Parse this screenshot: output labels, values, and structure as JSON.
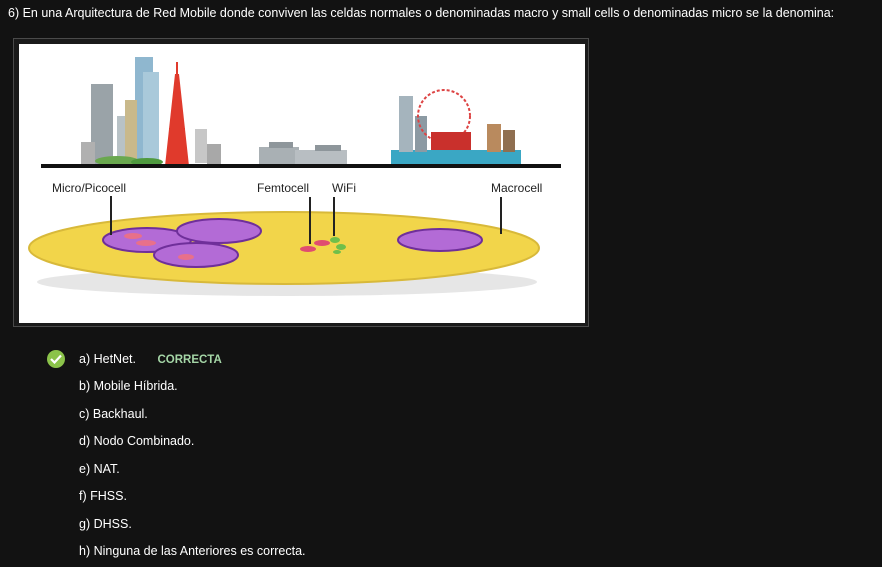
{
  "question": {
    "text": "6) En una Arquitectura de Red Mobile donde conviven las celdas normales o denominadas macro y small cells o denominadas micro se la denomina:"
  },
  "figure": {
    "labels": {
      "micro": "Micro/Picocell",
      "femto": "Femtocell",
      "wifi": "WiFi",
      "macro": "Macrocell"
    }
  },
  "options": [
    {
      "text": "a) HetNet.",
      "status": "CORRECTA",
      "correct": true
    },
    {
      "text": "b) Mobile Híbrida."
    },
    {
      "text": "c) Backhaul."
    },
    {
      "text": "d) Nodo Combinado."
    },
    {
      "text": "e) NAT."
    },
    {
      "text": "f) FHSS."
    },
    {
      "text": "g) DHSS."
    },
    {
      "text": "h) Ninguna de las Anteriores es correcta."
    }
  ],
  "colors": {
    "correct": "#8bc34a",
    "correct_text": "#a5d6a7",
    "background": "#121212"
  }
}
